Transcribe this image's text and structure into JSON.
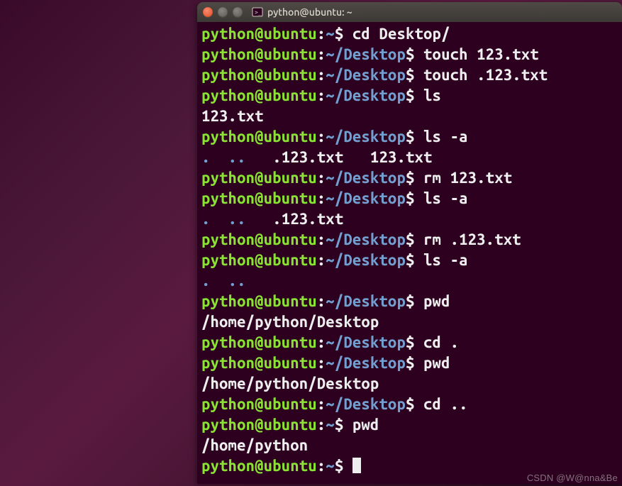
{
  "window": {
    "title": "python@ubuntu: ~",
    "buttons": {
      "close": "close-icon",
      "minimize": "minimize-icon",
      "maximize": "maximize-icon"
    }
  },
  "prompt": {
    "user_host": "python@ubuntu",
    "home_path": "~",
    "desktop_path": "~/Desktop",
    "sep": ":",
    "sigil": "$"
  },
  "session": {
    "lines": [
      {
        "type": "cmd",
        "path": "~",
        "command": "cd Desktop/"
      },
      {
        "type": "cmd",
        "path": "~/Desktop",
        "command": "touch 123.txt"
      },
      {
        "type": "cmd",
        "path": "~/Desktop",
        "command": "touch .123.txt"
      },
      {
        "type": "cmd",
        "path": "~/Desktop",
        "command": "ls"
      },
      {
        "type": "out",
        "text": "123.txt"
      },
      {
        "type": "cmd",
        "path": "~/Desktop",
        "command": "ls -a"
      },
      {
        "type": "out-dirs-files",
        "dirs": [
          ".",
          ".."
        ],
        "files": [
          ".123.txt",
          "123.txt"
        ]
      },
      {
        "type": "cmd",
        "path": "~/Desktop",
        "command": "rm 123.txt"
      },
      {
        "type": "cmd",
        "path": "~/Desktop",
        "command": "ls -a"
      },
      {
        "type": "out-dirs-files",
        "dirs": [
          ".",
          ".."
        ],
        "files": [
          ".123.txt"
        ]
      },
      {
        "type": "cmd",
        "path": "~/Desktop",
        "command": "rm .123.txt"
      },
      {
        "type": "cmd",
        "path": "~/Desktop",
        "command": "ls -a"
      },
      {
        "type": "out-dirs",
        "dirs": [
          ".",
          ".."
        ]
      },
      {
        "type": "cmd",
        "path": "~/Desktop",
        "command": "pwd"
      },
      {
        "type": "out",
        "text": "/home/python/Desktop"
      },
      {
        "type": "cmd",
        "path": "~/Desktop",
        "command": "cd ."
      },
      {
        "type": "cmd",
        "path": "~/Desktop",
        "command": "pwd"
      },
      {
        "type": "out",
        "text": "/home/python/Desktop"
      },
      {
        "type": "cmd",
        "path": "~/Desktop",
        "command": "cd .."
      },
      {
        "type": "cmd",
        "path": "~",
        "command": "pwd"
      },
      {
        "type": "out",
        "text": "/home/python"
      },
      {
        "type": "cmd",
        "path": "~",
        "command": "",
        "cursor": true
      }
    ]
  },
  "watermark": "CSDN @W@nna&Be"
}
